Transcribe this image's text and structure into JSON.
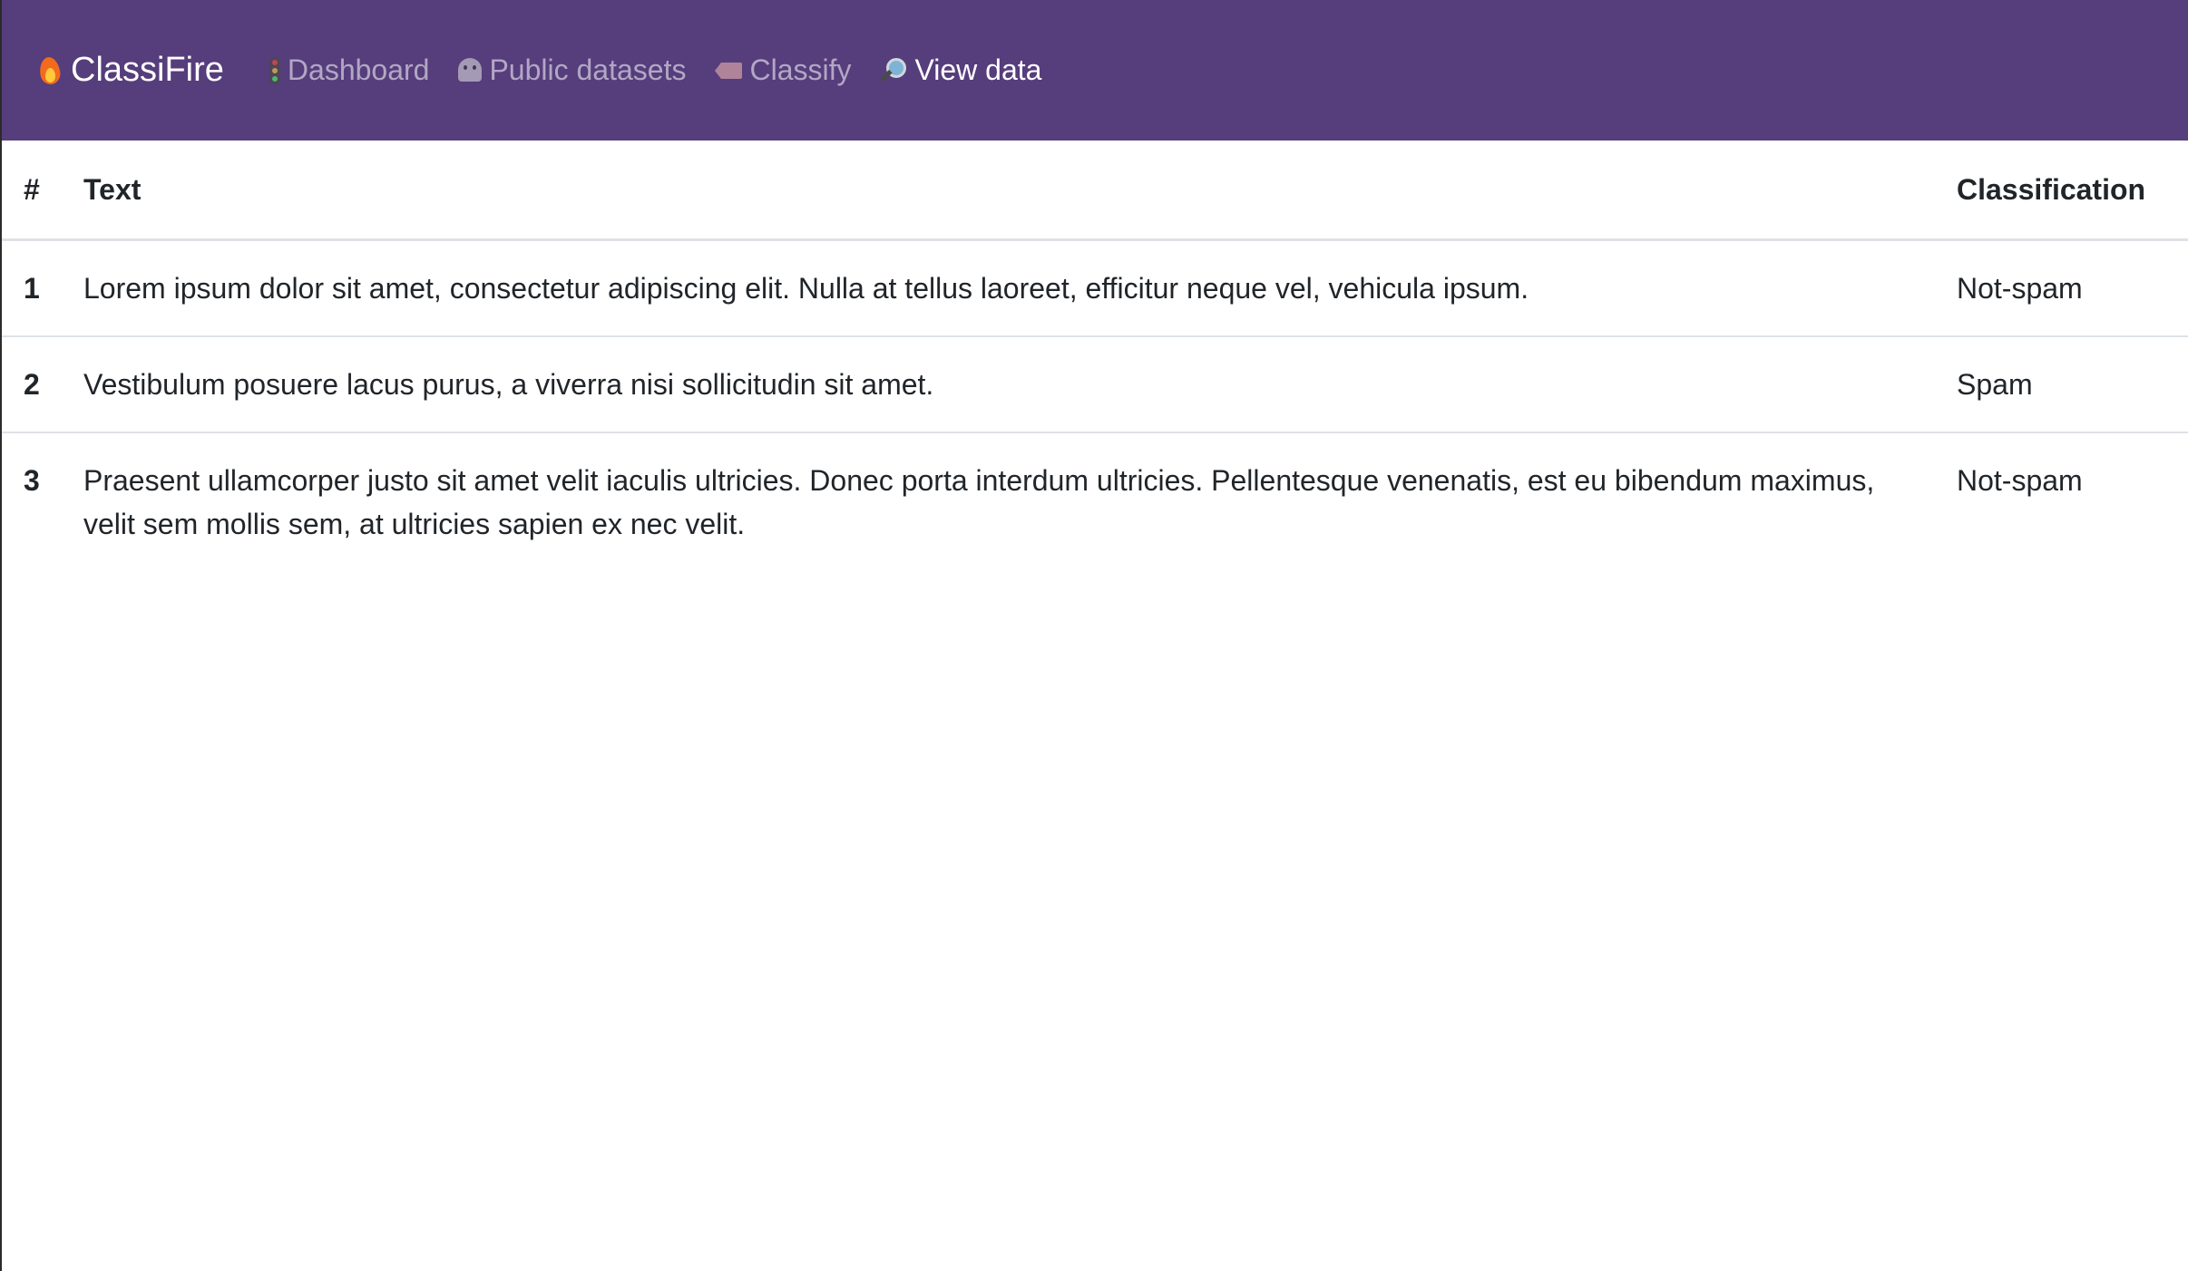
{
  "navbar": {
    "brand": {
      "label": "ClassiFire",
      "icon": "flame-icon"
    },
    "items": [
      {
        "label": "Dashboard",
        "icon": "traffic-light-icon",
        "active": false
      },
      {
        "label": "Public datasets",
        "icon": "ghost-icon",
        "active": false
      },
      {
        "label": "Classify",
        "icon": "tag-icon",
        "active": false
      },
      {
        "label": "View data",
        "icon": "magnifier-icon",
        "active": true
      }
    ],
    "background": "#563d7c"
  },
  "table": {
    "headers": {
      "num": "#",
      "text": "Text",
      "classification": "Classification"
    },
    "rows": [
      {
        "num": "1",
        "text": "Lorem ipsum dolor sit amet, consectetur adipiscing elit. Nulla at tellus laoreet, efficitur neque vel, vehicula ipsum.",
        "classification": "Not-spam"
      },
      {
        "num": "2",
        "text": "Vestibulum posuere lacus purus, a viverra nisi sollicitudin sit amet.",
        "classification": "Spam"
      },
      {
        "num": "3",
        "text": "Praesent ullamcorper justo sit amet velit iaculis ultricies. Donec porta interdum ultricies. Pellentesque venenatis, est eu bibendum maximus, velit sem mollis sem, at ultricies sapien ex nec velit.",
        "classification": "Not-spam"
      }
    ]
  }
}
